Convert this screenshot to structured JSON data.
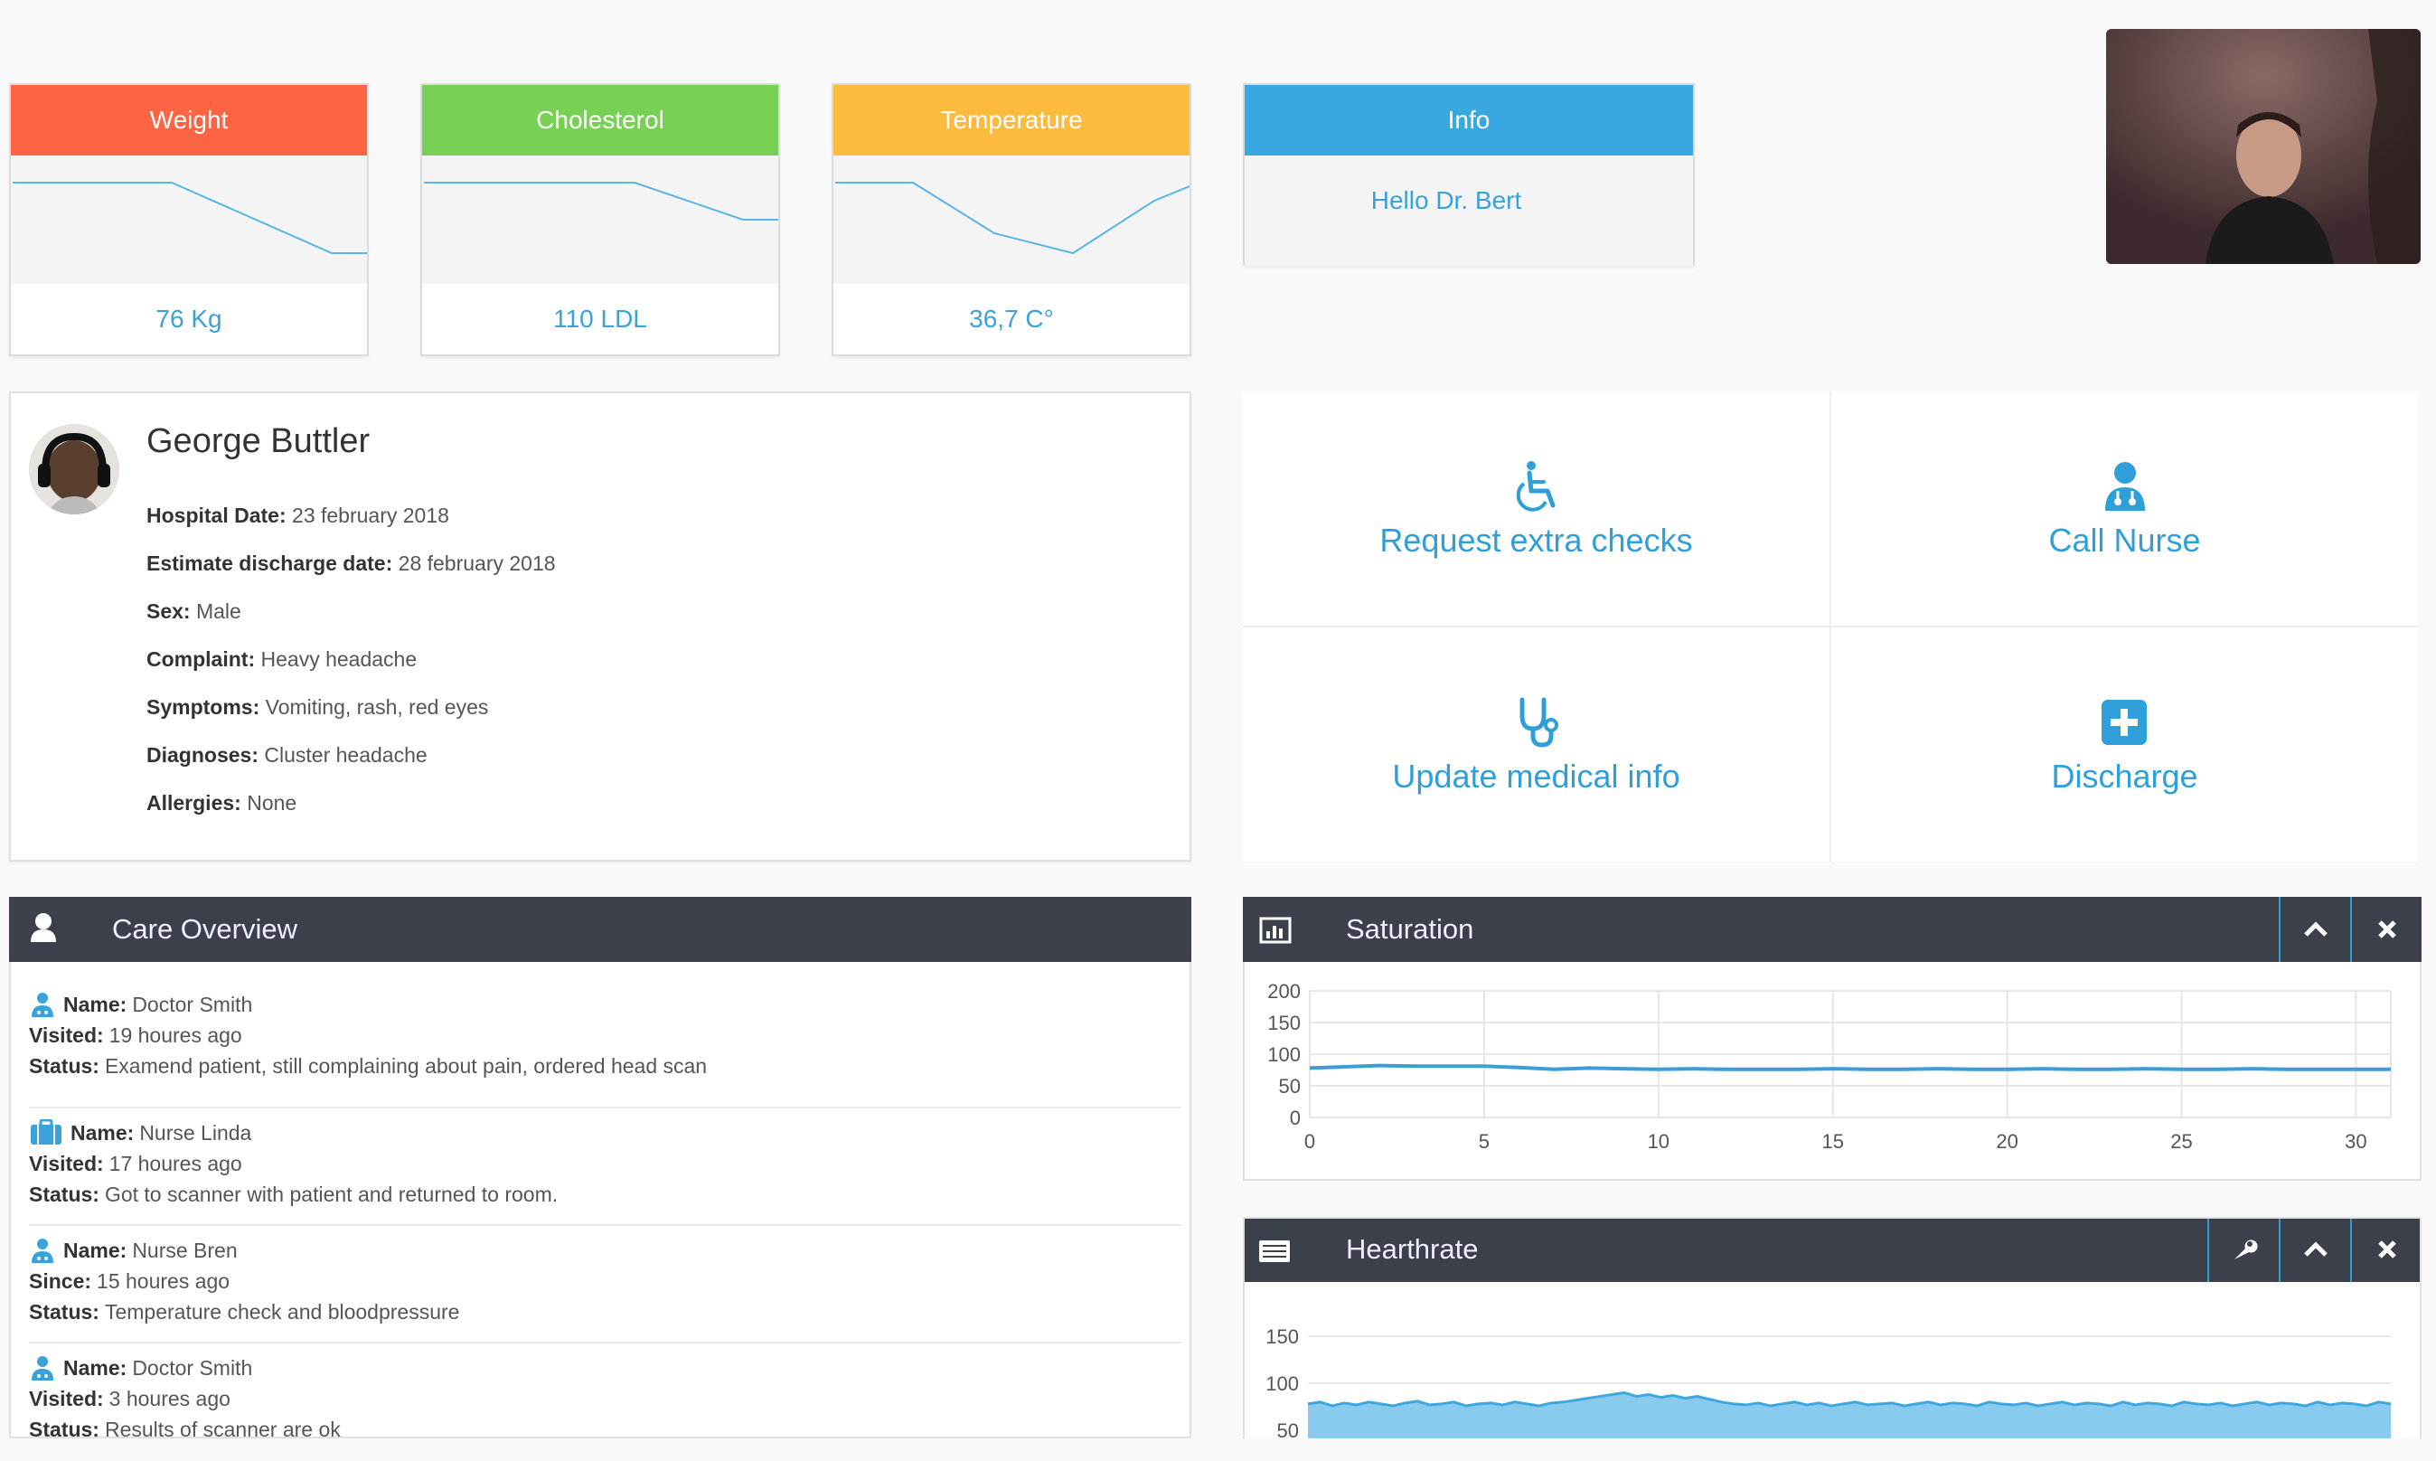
{
  "stats": [
    {
      "title": "Weight",
      "value": "76 Kg",
      "color": "#fd6443"
    },
    {
      "title": "Cholesterol",
      "value": "110 LDL",
      "color": "#78d155"
    },
    {
      "title": "Temperature",
      "value": "36,7 C°",
      "color": "#fdbb3e"
    }
  ],
  "info": {
    "title": "Info",
    "message": "Hello Dr. Bert",
    "color": "#3aa8e0"
  },
  "patient": {
    "name": "George Buttler",
    "details": [
      {
        "label": "Hospital Date:",
        "value": "23 february 2018"
      },
      {
        "label": "Estimate discharge date:",
        "value": "28 february 2018"
      },
      {
        "label": "Sex:",
        "value": "Male"
      },
      {
        "label": "Complaint:",
        "value": "Heavy headache"
      },
      {
        "label": "Symptoms:",
        "value": "Vomiting, rash, red eyes"
      },
      {
        "label": "Diagnoses:",
        "value": "Cluster headache"
      },
      {
        "label": "Allergies:",
        "value": "None"
      }
    ]
  },
  "actions": [
    {
      "label": "Request extra checks",
      "icon": "wheelchair-icon"
    },
    {
      "label": "Call Nurse",
      "icon": "nurse-icon"
    },
    {
      "label": "Update medical info",
      "icon": "stethoscope-icon"
    },
    {
      "label": "Discharge",
      "icon": "plus-square-icon"
    }
  ],
  "care": {
    "title": "Care Overview",
    "items": [
      {
        "l1": "Name:",
        "v1": "Doctor Smith",
        "l2": "Visited:",
        "v2": "19 houres ago",
        "l3": "Status:",
        "v3": "Examend patient, still complaining about pain, ordered head scan",
        "icon": "doctor-icon"
      },
      {
        "l1": "Name:",
        "v1": "Nurse Linda",
        "l2": "Visited:",
        "v2": "17 houres ago",
        "l3": "Status:",
        "v3": "Got to scanner with patient and returned to room.",
        "icon": "briefcase-icon"
      },
      {
        "l1": "Name:",
        "v1": "Nurse Bren",
        "l2": "Since:",
        "v2": "15 houres ago",
        "l3": "Status:",
        "v3": "Temperature check and bloodpressure",
        "icon": "doctor-icon"
      },
      {
        "l1": "Name:",
        "v1": "Doctor Smith",
        "l2": "Visited:",
        "v2": "3 houres ago",
        "l3": "Status:",
        "v3": "Results of scanner are ok",
        "icon": "doctor-icon"
      }
    ]
  },
  "widgets": {
    "saturation_title": "Saturation",
    "heartrate_title": "Hearthrate"
  },
  "chart_data": [
    {
      "type": "line",
      "x": [
        0,
        1,
        2,
        3,
        4,
        5,
        6,
        7,
        8,
        9,
        10,
        11,
        12,
        13,
        14,
        15,
        16,
        17,
        18,
        19,
        20,
        21,
        22,
        23,
        24,
        25,
        26,
        27,
        28,
        29,
        30,
        31
      ],
      "series": [
        {
          "values": [
            78,
            80,
            82,
            81,
            81,
            81,
            79,
            76,
            78,
            77,
            76,
            77,
            76,
            76,
            76,
            77,
            76,
            76,
            77,
            76,
            76,
            77,
            76,
            76,
            77,
            76,
            76,
            77,
            76,
            76,
            76,
            76
          ]
        }
      ],
      "xticks": [
        0,
        5,
        10,
        15,
        20,
        25,
        30
      ],
      "yticks": [
        0,
        50,
        100,
        150,
        200
      ],
      "ylim": [
        0,
        200
      ],
      "grid": true,
      "color": "#3e9cd6"
    },
    {
      "type": "area",
      "x": [
        0,
        1,
        2,
        3,
        4,
        5,
        6,
        7,
        8,
        9,
        10,
        11,
        12,
        13,
        14,
        15,
        16,
        17,
        18,
        19,
        20,
        21,
        22,
        23,
        24,
        25,
        26,
        27,
        28,
        29,
        30,
        31,
        32,
        33,
        34,
        35,
        36,
        37,
        38,
        39,
        40,
        41,
        42,
        43,
        44,
        45,
        46,
        47,
        48,
        49,
        50,
        51,
        52,
        53,
        54,
        55,
        56,
        57,
        58,
        59,
        60,
        61,
        62,
        63,
        64,
        65,
        66,
        67,
        68,
        69,
        70,
        71,
        72,
        73,
        74,
        75,
        76,
        77,
        78,
        79,
        80,
        81,
        82,
        83,
        84,
        85,
        86,
        87,
        88,
        89
      ],
      "series": [
        {
          "values": [
            78,
            80,
            76,
            79,
            77,
            80,
            78,
            76,
            79,
            81,
            77,
            78,
            80,
            76,
            78,
            79,
            77,
            80,
            78,
            76,
            79,
            80,
            82,
            84,
            86,
            88,
            90,
            86,
            88,
            85,
            87,
            84,
            86,
            83,
            80,
            78,
            77,
            79,
            76,
            78,
            80,
            77,
            79,
            76,
            78,
            80,
            77,
            78,
            79,
            76,
            78,
            80,
            77,
            79,
            78,
            76,
            80,
            78,
            77,
            79,
            76,
            78,
            80,
            77,
            79,
            78,
            76,
            80,
            77,
            79,
            78,
            76,
            80,
            78,
            77,
            79,
            76,
            78,
            80,
            77,
            79,
            78,
            76,
            80,
            77,
            79,
            78,
            76,
            80,
            78
          ]
        }
      ],
      "yticks": [
        50,
        100,
        150
      ],
      "ylim": [
        50,
        175
      ],
      "grid": true,
      "color": "#3ea7de"
    }
  ]
}
